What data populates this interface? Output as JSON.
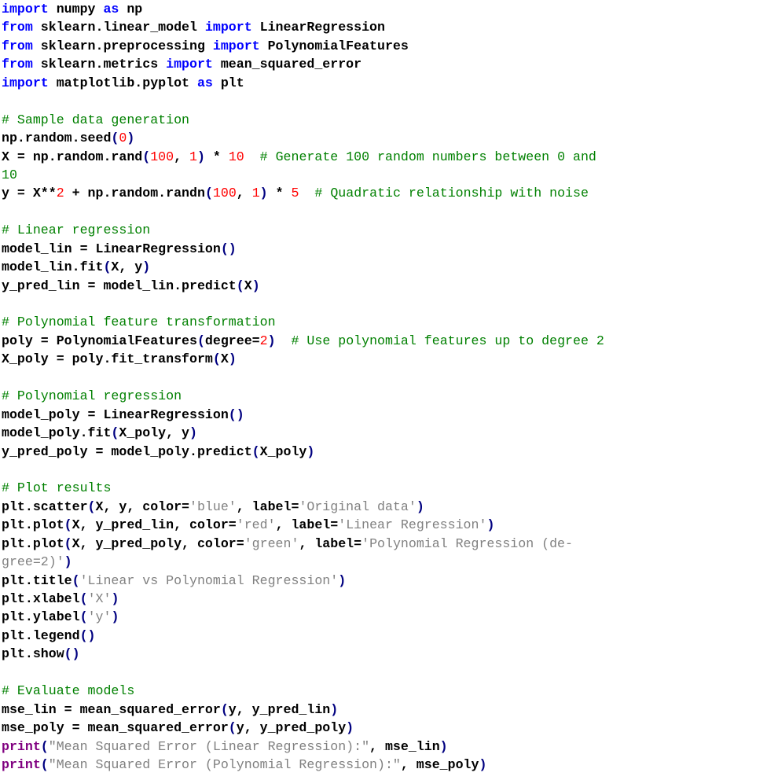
{
  "editor": {
    "language": "python",
    "colors": {
      "keyword": "#0000ff",
      "comment": "#008000",
      "number": "#ff0000",
      "string": "#808080",
      "bracket": "#000080",
      "builtin": "#800080",
      "text": "#000000"
    },
    "lines": [
      [
        [
          "kw",
          "import"
        ],
        [
          "tx",
          " numpy "
        ],
        [
          "kw",
          "as"
        ],
        [
          "tx",
          " np"
        ]
      ],
      [
        [
          "kw",
          "from"
        ],
        [
          "tx",
          " sklearn.linear_model "
        ],
        [
          "kw",
          "import"
        ],
        [
          "tx",
          " LinearRegression"
        ]
      ],
      [
        [
          "kw",
          "from"
        ],
        [
          "tx",
          " sklearn.preprocessing "
        ],
        [
          "kw",
          "import"
        ],
        [
          "tx",
          " PolynomialFeatures"
        ]
      ],
      [
        [
          "kw",
          "from"
        ],
        [
          "tx",
          " sklearn.metrics "
        ],
        [
          "kw",
          "import"
        ],
        [
          "tx",
          " mean_squared_error"
        ]
      ],
      [
        [
          "kw",
          "import"
        ],
        [
          "tx",
          " matplotlib.pyplot "
        ],
        [
          "kw",
          "as"
        ],
        [
          "tx",
          " plt"
        ]
      ],
      [],
      [
        [
          "cm",
          "# Sample data generation"
        ]
      ],
      [
        [
          "tx",
          "np.random.seed"
        ],
        [
          "op",
          "("
        ],
        [
          "nm",
          "0"
        ],
        [
          "op",
          ")"
        ]
      ],
      [
        [
          "tx",
          "X = np.random.rand"
        ],
        [
          "op",
          "("
        ],
        [
          "nm",
          "100"
        ],
        [
          "tx",
          ", "
        ],
        [
          "nm",
          "1"
        ],
        [
          "op",
          ")"
        ],
        [
          "tx",
          " * "
        ],
        [
          "nm",
          "10"
        ],
        [
          "tx",
          "  "
        ],
        [
          "cm",
          "# Generate 100 random numbers between 0 and"
        ]
      ],
      [
        [
          "cm",
          "10"
        ]
      ],
      [
        [
          "tx",
          "y = X**"
        ],
        [
          "nm",
          "2"
        ],
        [
          "tx",
          " + np.random.randn"
        ],
        [
          "op",
          "("
        ],
        [
          "nm",
          "100"
        ],
        [
          "tx",
          ", "
        ],
        [
          "nm",
          "1"
        ],
        [
          "op",
          ")"
        ],
        [
          "tx",
          " * "
        ],
        [
          "nm",
          "5"
        ],
        [
          "tx",
          "  "
        ],
        [
          "cm",
          "# Quadratic relationship with noise"
        ]
      ],
      [],
      [
        [
          "cm",
          "# Linear regression"
        ]
      ],
      [
        [
          "tx",
          "model_lin = LinearRegression"
        ],
        [
          "op",
          "()"
        ]
      ],
      [
        [
          "tx",
          "model_lin.fit"
        ],
        [
          "op",
          "("
        ],
        [
          "tx",
          "X, y"
        ],
        [
          "op",
          ")"
        ]
      ],
      [
        [
          "tx",
          "y_pred_lin = model_lin.predict"
        ],
        [
          "op",
          "("
        ],
        [
          "tx",
          "X"
        ],
        [
          "op",
          ")"
        ]
      ],
      [],
      [
        [
          "cm",
          "# Polynomial feature transformation"
        ]
      ],
      [
        [
          "tx",
          "poly = PolynomialFeatures"
        ],
        [
          "op",
          "("
        ],
        [
          "tx",
          "degree="
        ],
        [
          "nm",
          "2"
        ],
        [
          "op",
          ")"
        ],
        [
          "tx",
          "  "
        ],
        [
          "cm",
          "# Use polynomial features up to degree 2"
        ]
      ],
      [
        [
          "tx",
          "X_poly = poly.fit_transform"
        ],
        [
          "op",
          "("
        ],
        [
          "tx",
          "X"
        ],
        [
          "op",
          ")"
        ]
      ],
      [],
      [
        [
          "cm",
          "# Polynomial regression"
        ]
      ],
      [
        [
          "tx",
          "model_poly = LinearRegression"
        ],
        [
          "op",
          "()"
        ]
      ],
      [
        [
          "tx",
          "model_poly.fit"
        ],
        [
          "op",
          "("
        ],
        [
          "tx",
          "X_poly, y"
        ],
        [
          "op",
          ")"
        ]
      ],
      [
        [
          "tx",
          "y_pred_poly = model_poly.predict"
        ],
        [
          "op",
          "("
        ],
        [
          "tx",
          "X_poly"
        ],
        [
          "op",
          ")"
        ]
      ],
      [],
      [
        [
          "cm",
          "# Plot results"
        ]
      ],
      [
        [
          "tx",
          "plt.scatter"
        ],
        [
          "op",
          "("
        ],
        [
          "tx",
          "X, y, color="
        ],
        [
          "st",
          "'blue'"
        ],
        [
          "tx",
          ", label="
        ],
        [
          "st",
          "'Original data'"
        ],
        [
          "op",
          ")"
        ]
      ],
      [
        [
          "tx",
          "plt.plot"
        ],
        [
          "op",
          "("
        ],
        [
          "tx",
          "X, y_pred_lin, color="
        ],
        [
          "st",
          "'red'"
        ],
        [
          "tx",
          ", label="
        ],
        [
          "st",
          "'Linear Regression'"
        ],
        [
          "op",
          ")"
        ]
      ],
      [
        [
          "tx",
          "plt.plot"
        ],
        [
          "op",
          "("
        ],
        [
          "tx",
          "X, y_pred_poly, color="
        ],
        [
          "st",
          "'green'"
        ],
        [
          "tx",
          ", label="
        ],
        [
          "st",
          "'Polynomial Regression (de-"
        ]
      ],
      [
        [
          "st",
          "gree=2)'"
        ],
        [
          "op",
          ")"
        ]
      ],
      [
        [
          "tx",
          "plt.title"
        ],
        [
          "op",
          "("
        ],
        [
          "st",
          "'Linear vs Polynomial Regression'"
        ],
        [
          "op",
          ")"
        ]
      ],
      [
        [
          "tx",
          "plt.xlabel"
        ],
        [
          "op",
          "("
        ],
        [
          "st",
          "'X'"
        ],
        [
          "op",
          ")"
        ]
      ],
      [
        [
          "tx",
          "plt.ylabel"
        ],
        [
          "op",
          "("
        ],
        [
          "st",
          "'y'"
        ],
        [
          "op",
          ")"
        ]
      ],
      [
        [
          "tx",
          "plt.legend"
        ],
        [
          "op",
          "()"
        ]
      ],
      [
        [
          "tx",
          "plt.show"
        ],
        [
          "op",
          "()"
        ]
      ],
      [],
      [
        [
          "cm",
          "# Evaluate models"
        ]
      ],
      [
        [
          "tx",
          "mse_lin = mean_squared_error"
        ],
        [
          "op",
          "("
        ],
        [
          "tx",
          "y, y_pred_lin"
        ],
        [
          "op",
          ")"
        ]
      ],
      [
        [
          "tx",
          "mse_poly = mean_squared_error"
        ],
        [
          "op",
          "("
        ],
        [
          "tx",
          "y, y_pred_poly"
        ],
        [
          "op",
          ")"
        ]
      ],
      [
        [
          "bi",
          "print"
        ],
        [
          "op",
          "("
        ],
        [
          "st",
          "\"Mean Squared Error (Linear Regression):\""
        ],
        [
          "tx",
          ", mse_lin"
        ],
        [
          "op",
          ")"
        ]
      ],
      [
        [
          "bi",
          "print"
        ],
        [
          "op",
          "("
        ],
        [
          "st",
          "\"Mean Squared Error (Polynomial Regression):\""
        ],
        [
          "tx",
          ", mse_poly"
        ],
        [
          "op",
          ")"
        ]
      ]
    ]
  }
}
